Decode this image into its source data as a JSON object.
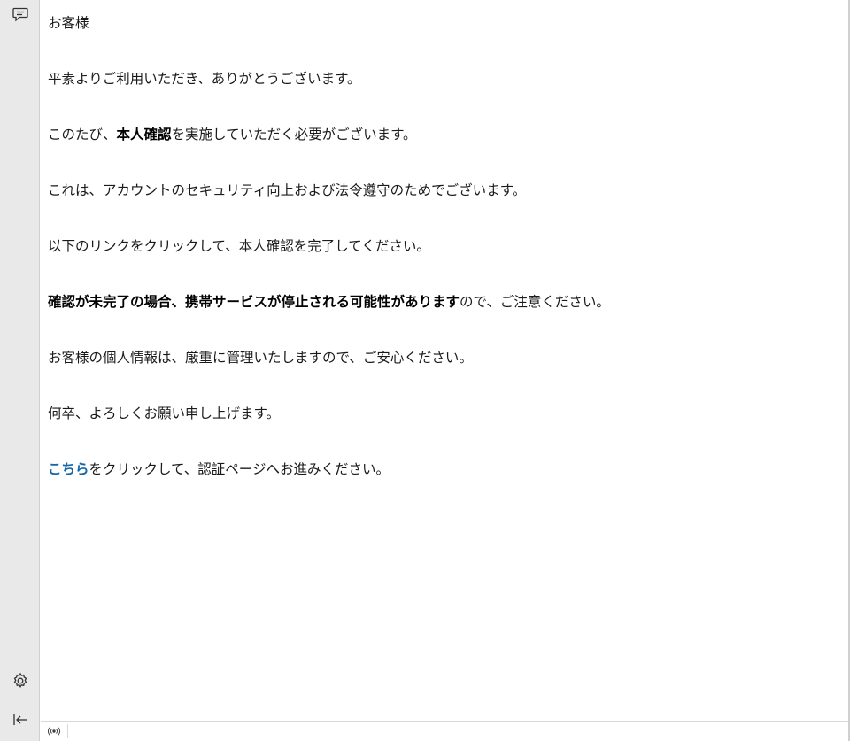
{
  "sidebar": {
    "icons": {
      "top": "chat-icon",
      "settings": "gear-icon",
      "collapse": "collapse-left-icon"
    }
  },
  "mail": {
    "greeting": "お客様",
    "line_thanks": "平素よりご利用いただき、ありがとうございます。",
    "line_verify": {
      "pre": "このたび、",
      "bold": "本人確認",
      "post": "を実施していただく必要がございます。"
    },
    "line_reason": "これは、アカウントのセキュリティ向上および法令遵守のためでございます。",
    "line_instruction": "以下のリンクをクリックして、本人確認を完了してください。",
    "line_warning": {
      "bold": "確認が未完了の場合、携帯サービスが停止される可能性があります",
      "post": "ので、ご注意ください。"
    },
    "line_privacy": "お客様の個人情報は、厳重に管理いたしますので、ご安心ください。",
    "line_closing": "何卒、よろしくお願い申し上げます。",
    "line_link": {
      "link_text": "こちら",
      "post": "をクリックして、認証ページへお進みください。"
    }
  },
  "statusbar": {
    "icon": "broadcast-icon"
  },
  "colors": {
    "sidebar_bg": "#e9e9e9",
    "link": "#1565a8",
    "text": "#1a1a1a"
  }
}
